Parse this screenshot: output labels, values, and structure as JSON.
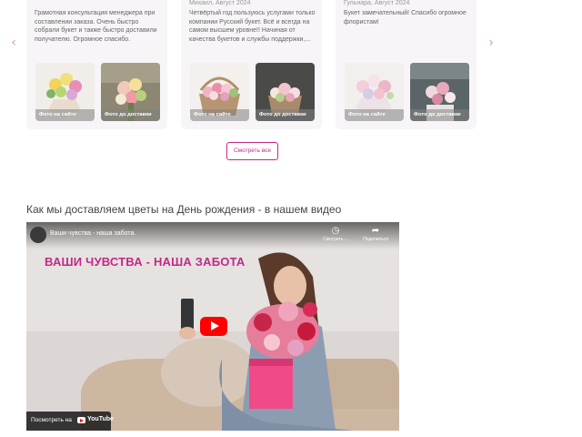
{
  "reviews": {
    "prev_arrow": "‹",
    "next_arrow": "›",
    "cards": [
      {
        "author": "",
        "text": "Грамотная консультация менеджера при составлении заказа. Очень быстро собрали букет и также быстро доставили получателю. Огромное спасибо.",
        "photo_site_label": "Фото на сайте",
        "photo_delivery_label": "Фото до доставки"
      },
      {
        "author": "Михаил, Август 2024",
        "text": "Четвёртый год пользуюсь услугами только компании Русский букет. Всё и всегда на самом высшем уровне!! Начиная от качества букетов и службы поддержки,...",
        "photo_site_label": "Фото на сайте",
        "photo_delivery_label": "Фото до доставки"
      },
      {
        "author": "Гульнара, Август 2024",
        "text": "Букет замечательный! Спасибо огромное флористам!",
        "photo_site_label": "Фото на сайте",
        "photo_delivery_label": "Фото до доставки"
      }
    ],
    "see_all_label": "Смотреть все"
  },
  "video_section": {
    "heading": "Как мы доставляем цветы на День рождения - в нашем видео",
    "video_title": "Ваши чувства - наша забота.",
    "watch_later_label": "Смотреть ...",
    "share_label": "Поделиться",
    "watch_later_icon": "clock-icon",
    "share_icon": "share-arrow-icon",
    "headline": "ВАШИ ЧУВСТВА - НАША ЗАБОТА",
    "watch_on_label": "Посмотреть на",
    "youtube_label": "YouTube"
  },
  "colors": {
    "accent": "#c42a87",
    "card_bg": "#f7f5f7",
    "play_button": "#ff0000"
  }
}
